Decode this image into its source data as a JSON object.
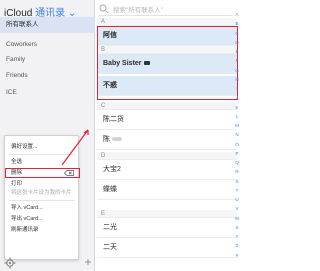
{
  "sidebar": {
    "title_prefix": "iCloud",
    "title_accent": "通讯录",
    "groups": [
      {
        "label": "所有联系人"
      },
      {
        "label": "Coworkers"
      },
      {
        "label": "Family"
      },
      {
        "label": "Friends"
      },
      {
        "label": "ICE"
      }
    ]
  },
  "search": {
    "placeholder": "搜索\"所有联系人\""
  },
  "sections": [
    "A",
    "B",
    "C",
    "D",
    "E"
  ],
  "contacts": [
    {
      "name": "阿信"
    },
    {
      "name": "Baby Sister"
    },
    {
      "name": "不惑"
    },
    {
      "name": "陈二货"
    },
    {
      "name": "陈"
    },
    {
      "name": "大宝2"
    },
    {
      "name": "蝶蝶"
    },
    {
      "name": "二光"
    },
    {
      "name": "二天"
    }
  ],
  "index_letters": [
    "A",
    "B",
    "C",
    "D",
    "E",
    "F",
    "G",
    "H",
    "I",
    "J",
    "K",
    "L",
    "M",
    "N",
    "O",
    "P",
    "Q",
    "R",
    "S",
    "T",
    "U",
    "V",
    "W",
    "X",
    "Y",
    "Z",
    "#"
  ],
  "menu": {
    "items": [
      {
        "label": "偏好设置..."
      },
      {
        "label": "全选"
      },
      {
        "label": "删除"
      },
      {
        "label": "打印"
      },
      {
        "label": "将这张卡片设为我的卡片"
      },
      {
        "label": "导入 vCard..."
      },
      {
        "label": "导出 vCard..."
      },
      {
        "label": "刷新通讯录"
      }
    ]
  },
  "colors": {
    "accent": "#3b82f6",
    "highlight_red": "#e0253a",
    "selection": "#dbeaf6"
  }
}
